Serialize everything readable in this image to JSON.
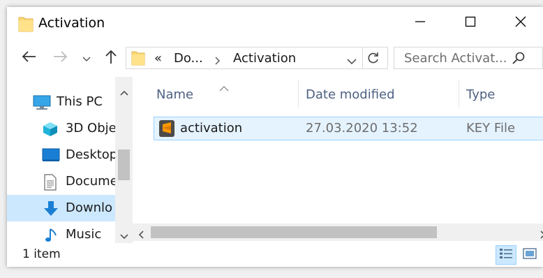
{
  "window": {
    "title": "Activation",
    "controls": [
      "minimize",
      "maximize",
      "close"
    ]
  },
  "navigation": {
    "address": {
      "overflow_marker": "«",
      "crumbs": [
        "Do...",
        "Activation"
      ]
    },
    "search": {
      "placeholder": "Search Activat..."
    }
  },
  "sidebar": {
    "items": [
      {
        "label": "This PC",
        "icon": "computer-icon",
        "selected": false
      },
      {
        "label": "3D Obje",
        "icon": "cube-icon",
        "selected": false
      },
      {
        "label": "Desktop",
        "icon": "desktop-icon",
        "selected": false
      },
      {
        "label": "Docume",
        "icon": "document-icon",
        "selected": false
      },
      {
        "label": "Downlo",
        "icon": "download-arrow-icon",
        "selected": true
      },
      {
        "label": "Music",
        "icon": "music-note-icon",
        "selected": false
      }
    ]
  },
  "file_list": {
    "columns": [
      "Name",
      "Date modified",
      "Type"
    ],
    "sorted_column": "Name",
    "rows": [
      {
        "name": "activation",
        "date_modified": "27.03.2020 13:52",
        "type": "KEY File",
        "icon": "sublime-text-icon"
      }
    ]
  },
  "status": {
    "item_count": "1 item"
  },
  "colors": {
    "accent": "#0078d7",
    "selection_bg": "#e5f3ff",
    "selection_border": "#99d1ff",
    "header_text": "#4d6082"
  }
}
